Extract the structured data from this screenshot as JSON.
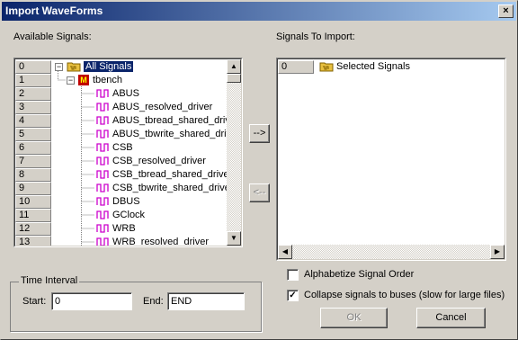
{
  "window": {
    "title": "Import WaveForms"
  },
  "labels": {
    "available_signals": "Available Signals:",
    "signals_to_import": "Signals To Import:"
  },
  "available_tree": {
    "row_numbers": [
      "0",
      "1",
      "2",
      "3",
      "4",
      "5",
      "6",
      "7",
      "8",
      "9",
      "10",
      "11",
      "12",
      "13"
    ],
    "root_label": "All Signals",
    "module_label": "tbench",
    "signals": [
      "ABUS",
      "ABUS_resolved_driver",
      "ABUS_tbread_shared_driv",
      "ABUS_tbwrite_shared_driv",
      "CSB",
      "CSB_resolved_driver",
      "CSB_tbread_shared_drive",
      "CSB_tbwrite_shared_drive",
      "DBUS",
      "GClock",
      "WRB",
      "WRB_resolved_driver"
    ]
  },
  "import_tree": {
    "row_number": "0",
    "root_label": "Selected Signals"
  },
  "buttons": {
    "add": "-->",
    "remove": "<--",
    "ok": "OK",
    "cancel": "Cancel"
  },
  "time_interval": {
    "title": "Time Interval",
    "start_label": "Start:",
    "start_value": "0",
    "end_label": "End:",
    "end_value": "END"
  },
  "options": {
    "alphabetize_label": "Alphabetize Signal Order",
    "alphabetize_checked": false,
    "collapse_label": "Collapse signals to buses (slow for large files)",
    "collapse_checked": true
  },
  "colors": {
    "title_start": "#0a246a",
    "title_end": "#a6caf0",
    "wave_icon": "#cc00cc",
    "folder": "#e8c040"
  }
}
